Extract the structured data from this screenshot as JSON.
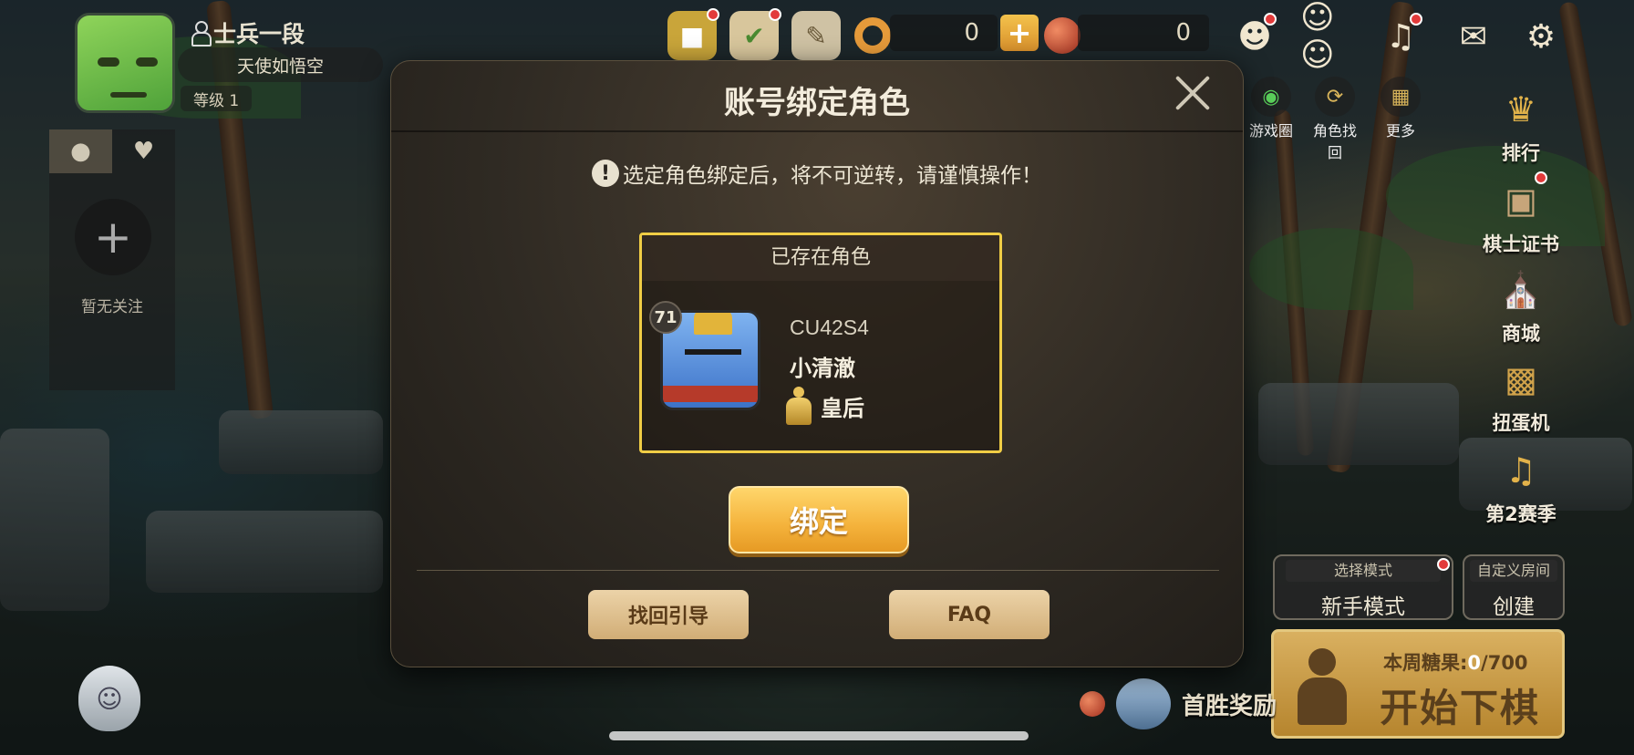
{
  "player": {
    "rank": "士兵一段",
    "nickname": "天使如悟空",
    "level": "等级 1"
  },
  "friends_panel": {
    "add_symbol": "+",
    "empty_text": "暂无关注"
  },
  "currency": {
    "candy": "0",
    "plus": "+",
    "balls": "0"
  },
  "quick_links": {
    "game_circle": "游戏圈",
    "role_recover": "角色找回",
    "more": "更多"
  },
  "side_menu": {
    "ranking": "排行",
    "certificate": "棋士证书",
    "shop": "商城",
    "gacha": "扭蛋机",
    "season": "第2赛季"
  },
  "mode": {
    "select_label": "选择模式",
    "select_value": "新手模式",
    "custom_label": "自定义房间",
    "custom_value": "创建"
  },
  "start": {
    "weekly_prefix": "本周糖果:",
    "weekly_current": "0",
    "weekly_total": "/700",
    "label": "开始下棋"
  },
  "first_win": "首胜奖励",
  "dialog": {
    "title": "账号绑定角色",
    "warning": "选定角色绑定后，将不可逆转，请谨慎操作！",
    "warning_icon": "!",
    "card_header": "已存在角色",
    "character": {
      "level": "71",
      "id": "CU42S4",
      "name": "小清澈",
      "rank": "皇后"
    },
    "bind_button": "绑定",
    "recover_guide": "找回引导",
    "faq": "FAQ"
  },
  "colors": {
    "card_border": "#f0cd45",
    "bind_button": "#f4b23b",
    "notification": "#e23a3a"
  }
}
